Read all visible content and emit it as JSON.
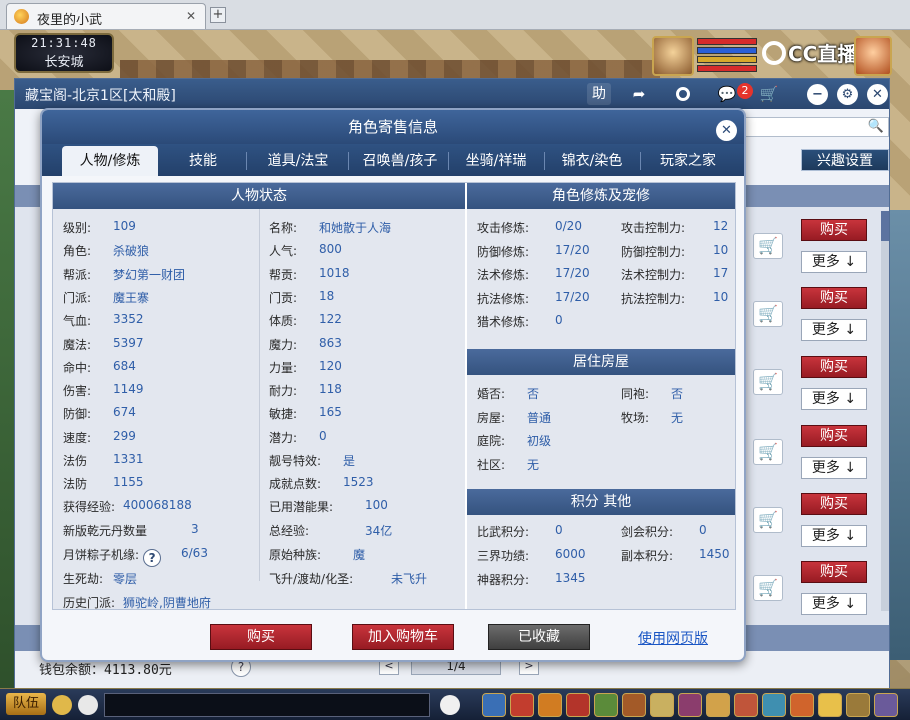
{
  "browser": {
    "tab_title": "夜里的小武",
    "tab_close": "✕",
    "new_tab": "+"
  },
  "game": {
    "clock_time": "21:31:48",
    "city": "长安城",
    "cc_logo": "CC直播"
  },
  "outer": {
    "title": "藏宝阁-北京1区[太和殿]",
    "help_label": "助",
    "notification_count": "2",
    "hobby_button": "兴趣设置",
    "rows": [
      {
        "buy": "购买",
        "more": "更多 ↓"
      },
      {
        "buy": "购买",
        "more": "更多 ↓"
      },
      {
        "buy": "购买",
        "more": "更多 ↓"
      },
      {
        "buy": "购买",
        "more": "更多 ↓"
      },
      {
        "buy": "购买",
        "more": "更多 ↓"
      },
      {
        "buy": "购买",
        "more": "更多 ↓"
      }
    ],
    "wallet_label": "钱包余额：",
    "wallet_value": "4113.80元",
    "help_q": "?",
    "pager": "1/4",
    "pager_prev": "<",
    "pager_next": ">"
  },
  "modal": {
    "title": "角色寄售信息",
    "close": "✕",
    "tabs": [
      {
        "label": "人物/修炼",
        "active": true
      },
      {
        "label": "技能"
      },
      {
        "label": "道具/法宝"
      },
      {
        "label": "召唤兽/孩子"
      },
      {
        "label": "坐骑/祥瑞"
      },
      {
        "label": "锦衣/染色"
      },
      {
        "label": "玩家之家"
      }
    ],
    "char_status": {
      "title": "人物状态",
      "left": [
        {
          "label": "级别:",
          "value": "109"
        },
        {
          "label": "角色:",
          "value": "杀破狼"
        },
        {
          "label": "帮派:",
          "value": "梦幻第一财团"
        },
        {
          "label": "门派:",
          "value": "魔王寨"
        },
        {
          "label": "气血:",
          "value": "3352"
        },
        {
          "label": "魔法:",
          "value": "5397"
        },
        {
          "label": "命中:",
          "value": "684"
        },
        {
          "label": "伤害:",
          "value": "1149"
        },
        {
          "label": "防御:",
          "value": "674"
        },
        {
          "label": "速度:",
          "value": "299"
        },
        {
          "label": "法伤",
          "value": "1331"
        },
        {
          "label": "法防",
          "value": "1155"
        }
      ],
      "right": [
        {
          "label": "名称:",
          "value": "和她散于人海"
        },
        {
          "label": "人气:",
          "value": "800"
        },
        {
          "label": "帮贡:",
          "value": "1018"
        },
        {
          "label": "门贡:",
          "value": "18"
        },
        {
          "label": "体质:",
          "value": "122"
        },
        {
          "label": "魔力:",
          "value": "863"
        },
        {
          "label": "力量:",
          "value": "120"
        },
        {
          "label": "耐力:",
          "value": "118"
        },
        {
          "label": "敏捷:",
          "value": "165"
        },
        {
          "label": "潜力:",
          "value": "0"
        },
        {
          "label": "靓号特效:",
          "value": "是"
        },
        {
          "label": "成就点数:",
          "value": "1523"
        }
      ],
      "extra_left": [
        {
          "label": "获得经验:",
          "value": "400068188"
        },
        {
          "label": "新版乾元丹数量",
          "value": "3"
        },
        {
          "label": "月饼粽子机缘:",
          "value": "6/63",
          "help": "?"
        },
        {
          "label": "生死劫:",
          "value": "零层"
        },
        {
          "label": "历史门派:",
          "value": "狮驼岭,阴曹地府"
        }
      ],
      "extra_right": [
        {
          "label": "已用潜能果:",
          "value": "100"
        },
        {
          "label": "总经验:",
          "value": "34亿"
        },
        {
          "label": "原始种族:",
          "value": "魔"
        },
        {
          "label": "飞升/渡劫/化圣:",
          "value": "未飞升"
        }
      ]
    },
    "cultivation": {
      "title": "角色修炼及宠修",
      "rows": [
        {
          "l1": "攻击修炼:",
          "v1": "0/20",
          "l2": "攻击控制力:",
          "v2": "12"
        },
        {
          "l1": "防御修炼:",
          "v1": "17/20",
          "l2": "防御控制力:",
          "v2": "10"
        },
        {
          "l1": "法术修炼:",
          "v1": "17/20",
          "l2": "法术控制力:",
          "v2": "17"
        },
        {
          "l1": "抗法修炼:",
          "v1": "17/20",
          "l2": "抗法控制力:",
          "v2": "10"
        },
        {
          "l1": "猎术修炼:",
          "v1": "0",
          "l2": "",
          "v2": ""
        }
      ]
    },
    "house": {
      "title": "居住房屋",
      "rows": [
        {
          "l1": "婚否:",
          "v1": "否",
          "l2": "同袍:",
          "v2": "否"
        },
        {
          "l1": "房屋:",
          "v1": "普通",
          "l2": "牧场:",
          "v2": "无"
        },
        {
          "l1": "庭院:",
          "v1": "初级",
          "l2": "",
          "v2": ""
        },
        {
          "l1": "社区:",
          "v1": "无",
          "l2": "",
          "v2": ""
        }
      ]
    },
    "points": {
      "title": "积分 其他",
      "rows": [
        {
          "l1": "比武积分:",
          "v1": "0",
          "l2": "剑会积分:",
          "v2": "0"
        },
        {
          "l1": "三界功绩:",
          "v1": "6000",
          "l2": "副本积分:",
          "v2": "1450"
        },
        {
          "l1": "神器积分:",
          "v1": "1345",
          "l2": "",
          "v2": ""
        }
      ]
    },
    "buttons": {
      "buy": "购买",
      "add_cart": "加入购物车",
      "favorited": "已收藏",
      "web_version": "使用网页版"
    }
  },
  "taskbar": {
    "team": "队伍"
  },
  "colors": {
    "title_blue": "#2b4a78",
    "value_blue": "#2f5ea8",
    "buy_red": "#b1252e"
  }
}
